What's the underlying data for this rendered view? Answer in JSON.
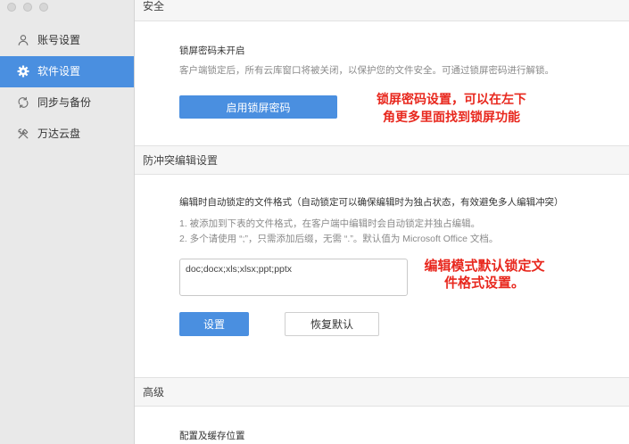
{
  "colors": {
    "accent": "#4a8fe0",
    "annotation": "#e8281e",
    "sidebar_bg": "#e9e9e9",
    "header_bg": "#f6f6f6"
  },
  "sidebar": {
    "items": [
      {
        "label": "账号设置",
        "icon": "person-icon",
        "selected": false
      },
      {
        "label": "软件设置",
        "icon": "gear-icon",
        "selected": true
      },
      {
        "label": "同步与备份",
        "icon": "sync-icon",
        "selected": false
      },
      {
        "label": "万达云盘",
        "icon": "tools-icon",
        "selected": false
      }
    ]
  },
  "security": {
    "title": "安全",
    "lock_status": "锁屏密码未开启",
    "lock_desc": "客户端锁定后，所有云库窗口将被关闭，以保护您的文件安全。可通过锁屏密码进行解锁。",
    "enable_button": "启用锁屏密码",
    "annotation_line1": "锁屏密码设置，可以在左下",
    "annotation_line2": "角更多里面找到锁屏功能"
  },
  "conflict": {
    "title": "防冲突编辑设置",
    "heading": "编辑时自动锁定的文件格式（自动锁定可以确保编辑时为独占状态，有效避免多人编辑冲突）",
    "note1": "1. 被添加到下表的文件格式，在客户端中编辑时会自动锁定并独占编辑。",
    "note2": "2. 多个请使用 “;”，只需添加后缀，无需 “.”。默认值为 Microsoft Office 文档。",
    "formats_value": "doc;docx;xls;xlsx;ppt;pptx",
    "set_button": "设置",
    "reset_button": "恢复默认",
    "annotation_line1": "编辑模式默认锁定文",
    "annotation_line2": "件格式设置。"
  },
  "advanced": {
    "title": "高级",
    "config_label": "配置及缓存位置"
  }
}
